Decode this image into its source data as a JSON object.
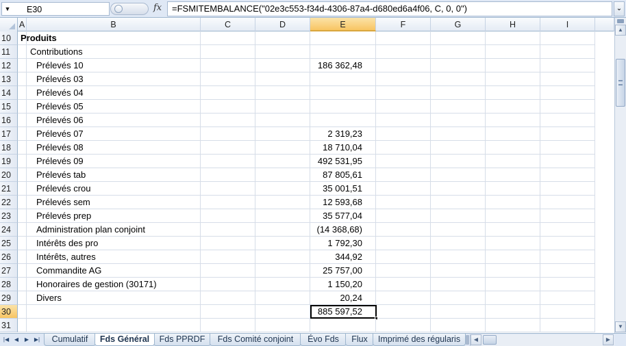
{
  "formula_bar": {
    "name_box": "E30",
    "fx_label": "fx",
    "formula": "=FSMITEMBALANCE(\"02e3c553-f34d-4306-87a4-d680ed6a4f06, C, 0, 0\")"
  },
  "columns": [
    "A",
    "B",
    "C",
    "D",
    "E",
    "F",
    "G",
    "H",
    "I"
  ],
  "selected_column": "E",
  "selected_row": "30",
  "rows": [
    {
      "n": "10",
      "label": "Produits",
      "value": "",
      "bold": true,
      "indent": 0
    },
    {
      "n": "11",
      "label": "Contributions",
      "value": "",
      "bold": false,
      "indent": 1
    },
    {
      "n": "12",
      "label": "Prélevés 10",
      "value": "186 362,48",
      "bold": false,
      "indent": 2
    },
    {
      "n": "13",
      "label": "Prélevés 03",
      "value": "",
      "bold": false,
      "indent": 2
    },
    {
      "n": "14",
      "label": "Prélevés 04",
      "value": "",
      "bold": false,
      "indent": 2
    },
    {
      "n": "15",
      "label": "Prélevés 05",
      "value": "",
      "bold": false,
      "indent": 2
    },
    {
      "n": "16",
      "label": "Prélevés 06",
      "value": "",
      "bold": false,
      "indent": 2
    },
    {
      "n": "17",
      "label": "Prélevés 07",
      "value": "2 319,23",
      "bold": false,
      "indent": 2
    },
    {
      "n": "18",
      "label": "Prélevés 08",
      "value": "18 710,04",
      "bold": false,
      "indent": 2
    },
    {
      "n": "19",
      "label": "Prélevés 09",
      "value": "492 531,95",
      "bold": false,
      "indent": 2
    },
    {
      "n": "20",
      "label": "Prélevés tab",
      "value": "87 805,61",
      "bold": false,
      "indent": 2
    },
    {
      "n": "21",
      "label": "Prélevés crou",
      "value": "35 001,51",
      "bold": false,
      "indent": 2
    },
    {
      "n": "22",
      "label": "Prélevés sem",
      "value": "12 593,68",
      "bold": false,
      "indent": 2
    },
    {
      "n": "23",
      "label": "Prélevés prep",
      "value": "35 577,04",
      "bold": false,
      "indent": 2
    },
    {
      "n": "24",
      "label": "Administration plan conjoint",
      "value": "(14 368,68)",
      "bold": false,
      "indent": 2
    },
    {
      "n": "25",
      "label": "Intérêts des pro",
      "value": "1 792,30",
      "bold": false,
      "indent": 2
    },
    {
      "n": "26",
      "label": "Intérêts, autres",
      "value": "344,92",
      "bold": false,
      "indent": 2
    },
    {
      "n": "27",
      "label": "Commandite AG",
      "value": "25 757,00",
      "bold": false,
      "indent": 2
    },
    {
      "n": "28",
      "label": "Honoraires de gestion (30171)",
      "value": "1 150,20",
      "bold": false,
      "indent": 2
    },
    {
      "n": "29",
      "label": "Divers",
      "value": "20,24",
      "bold": false,
      "indent": 2
    },
    {
      "n": "30",
      "label": "",
      "value": "885 597,52",
      "bold": false,
      "indent": 2
    },
    {
      "n": "31",
      "label": "",
      "value": "",
      "bold": false,
      "indent": 2
    }
  ],
  "sheet_tabs": [
    {
      "label": "Cumulatif",
      "active": false
    },
    {
      "label": "Fds Général",
      "active": true
    },
    {
      "label": "Fds PPRDF",
      "active": false
    },
    {
      "label": "Fds Comité conjoint",
      "active": false
    },
    {
      "label": "Évo Fds",
      "active": false
    },
    {
      "label": "Flux",
      "active": false
    },
    {
      "label": "Imprimé des régularis",
      "active": false
    }
  ],
  "icons": {
    "name_box_dropdown": "chevron-down-icon",
    "formula_expand": "double-chevron-down-icon",
    "tab_nav_first": "first-sheet-icon",
    "tab_nav_prev": "prev-sheet-icon",
    "tab_nav_next": "next-sheet-icon",
    "tab_nav_last": "last-sheet-icon"
  }
}
